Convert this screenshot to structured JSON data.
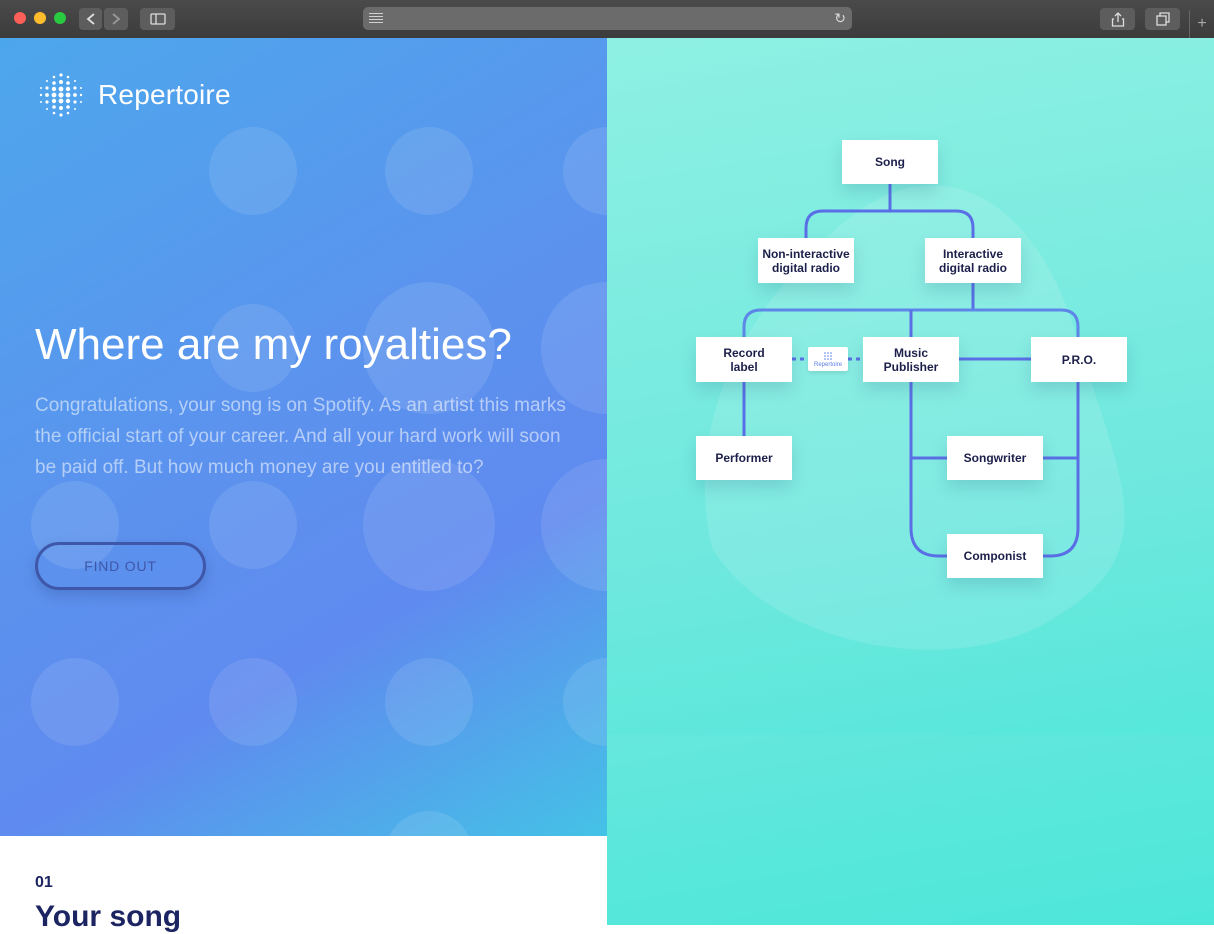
{
  "browser": {
    "back_icon": "chevron-left-icon",
    "forward_icon": "chevron-right-icon",
    "reload_icon": "reload-icon",
    "share_icon": "share-icon",
    "tabs_icon": "tabs-icon",
    "new_tab_label": "+"
  },
  "brand": {
    "name": "Repertoire"
  },
  "hero": {
    "title": "Where are my royalties?",
    "text": "Congratulations, your song is on Spotify. As an artist this marks the official start of your career. And all your hard work will soon be paid off. But how much money are you entitled to?",
    "cta": "FIND OUT"
  },
  "section": {
    "number": "01",
    "title": "Your song"
  },
  "diagram": {
    "nodes": {
      "song": "Song",
      "non_interactive": "Non-interactive\ndigital radio",
      "interactive": "Interactive\ndigital radio",
      "record_label": "Record\nlabel",
      "music_publisher": "Music\nPublisher",
      "pro": "P.R.O.",
      "performer": "Performer",
      "songwriter": "Songwriter",
      "componist": "Componist"
    },
    "badge": "Repertoire"
  },
  "colors": {
    "navy": "#1c2462",
    "line": "#5a6fe6",
    "accent": "#3f57a8"
  }
}
